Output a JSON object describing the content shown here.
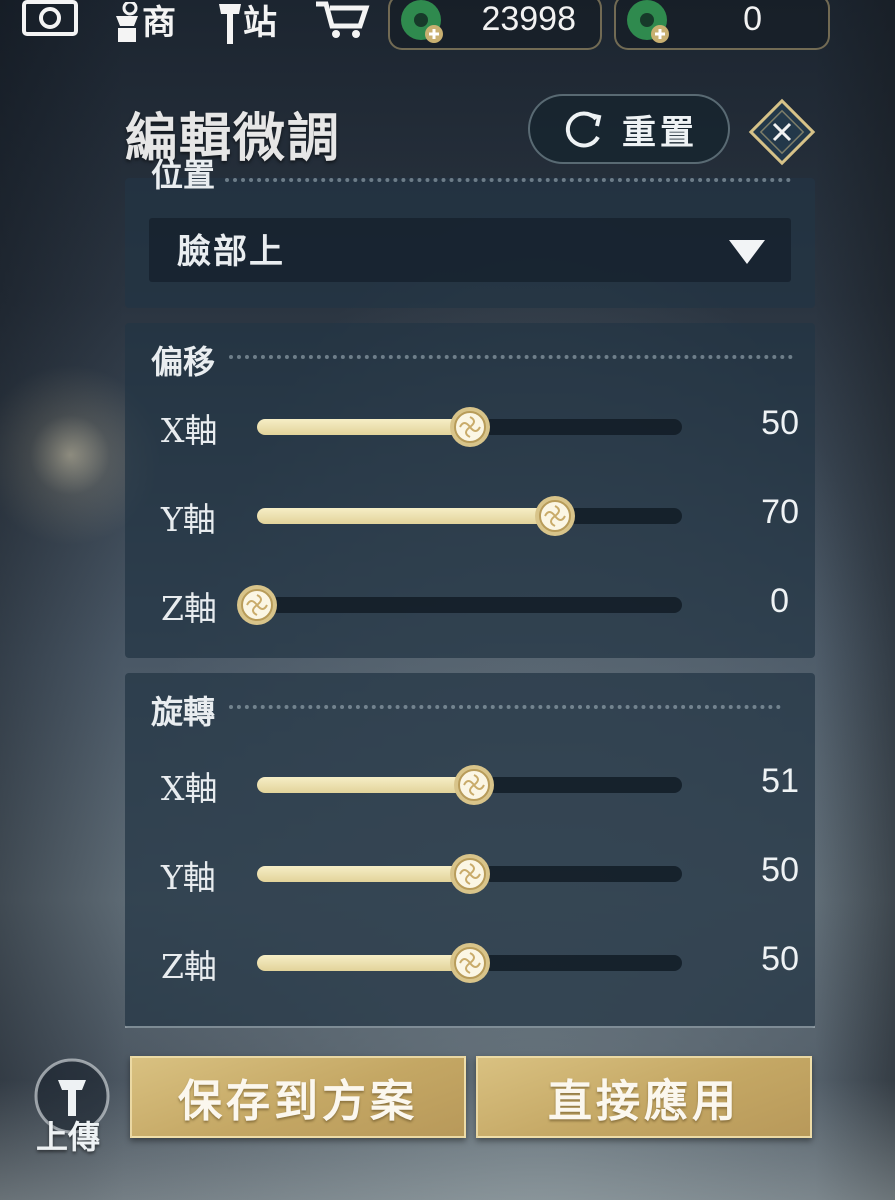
{
  "topbar": {
    "shop_label": "商",
    "station_label": "站",
    "currency_1_value": "23998",
    "currency_2_value": "0"
  },
  "panel": {
    "title": "編輯微調",
    "reset_label": "重置"
  },
  "position_section": {
    "label": "位置",
    "dropdown_value": "臉部上"
  },
  "offset_section": {
    "label": "偏移",
    "sliders": [
      {
        "axis": "X軸",
        "value": "50",
        "fill": 0.5
      },
      {
        "axis": "Y軸",
        "value": "70",
        "fill": 0.7
      },
      {
        "axis": "Z軸",
        "value": "0",
        "fill": 0.0
      }
    ]
  },
  "rotate_section": {
    "label": "旋轉",
    "sliders": [
      {
        "axis": "X軸",
        "value": "51",
        "fill": 0.51
      },
      {
        "axis": "Y軸",
        "value": "50",
        "fill": 0.5
      },
      {
        "axis": "Z軸",
        "value": "50",
        "fill": 0.5
      }
    ]
  },
  "actions": {
    "upload_label": "上傳",
    "save_label": "保存到方案",
    "apply_label": "直接應用"
  },
  "colors": {
    "accent_gold": "#c4a764",
    "slider_fill": "#f0e6b6",
    "panel_bg": "#223444"
  }
}
